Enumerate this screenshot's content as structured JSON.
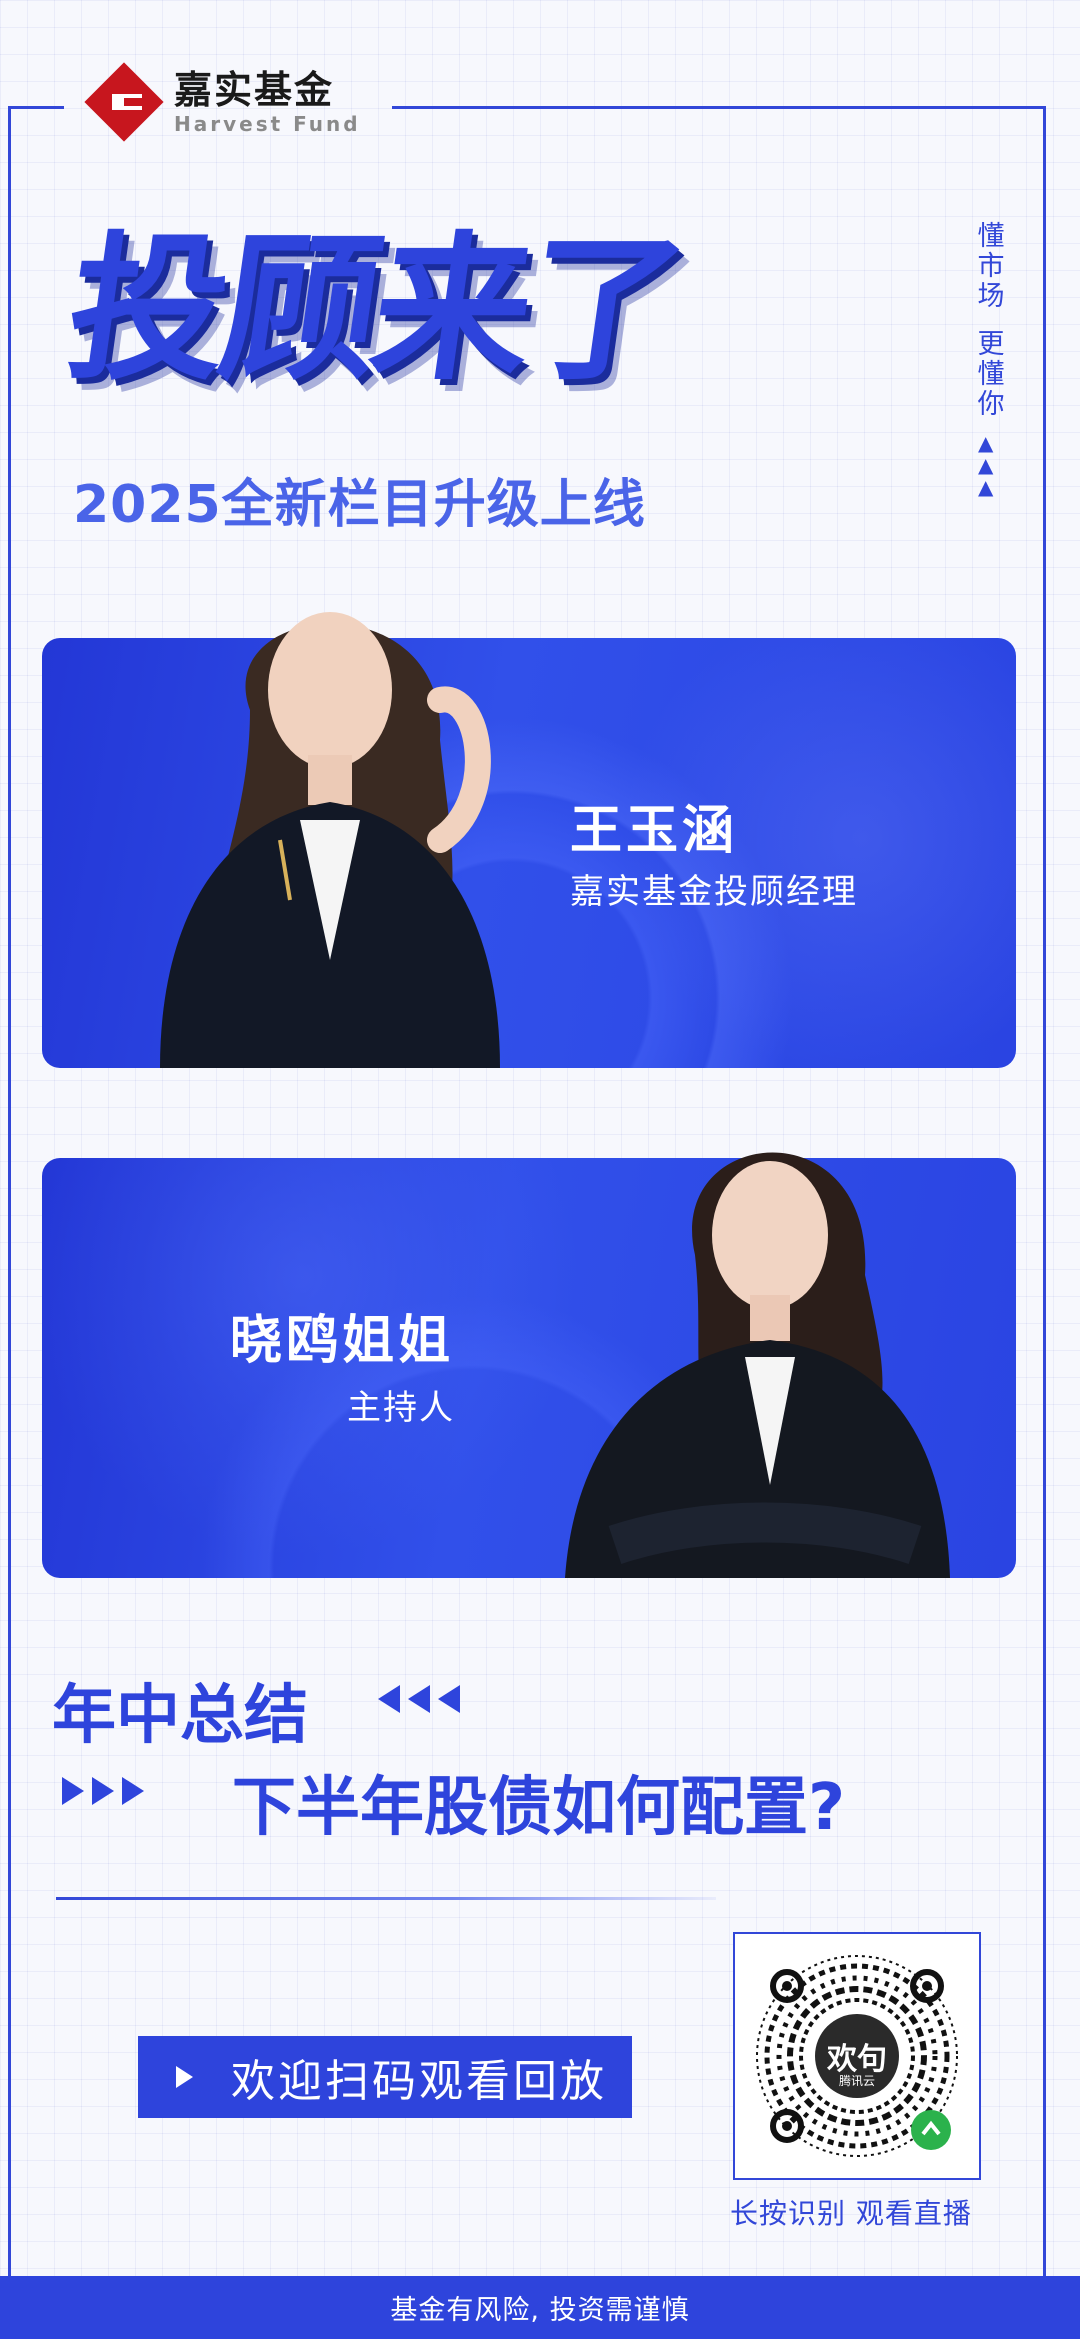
{
  "brand": {
    "name_cn": "嘉实基金",
    "name_en": "Harvest Fund",
    "accent": "#2e44dc",
    "logo_red": "#c7161e"
  },
  "hero": {
    "title": "投顾来了",
    "subtitle": "2025全新栏目升级上线"
  },
  "side_slogan": {
    "line1": [
      "懂",
      "市",
      "场"
    ],
    "line2": [
      "更",
      "懂",
      "你"
    ],
    "arrows_icon": "triangle-up-icon"
  },
  "guest": {
    "name": "王玉涵",
    "role": "嘉实基金投顾经理"
  },
  "host": {
    "name": "晓鸥姐姐",
    "role": "主持人"
  },
  "topics": {
    "line1": "年中总结",
    "line2": "下半年股债如何配置?"
  },
  "cta": {
    "label": "欢迎扫码观看回放",
    "icon": "play-icon"
  },
  "qr": {
    "center_text": "欢句",
    "center_sub": "腾讯云",
    "caption": "长按识别  观看直播"
  },
  "footer": {
    "disclaimer": "基金有风险, 投资需谨慎"
  }
}
